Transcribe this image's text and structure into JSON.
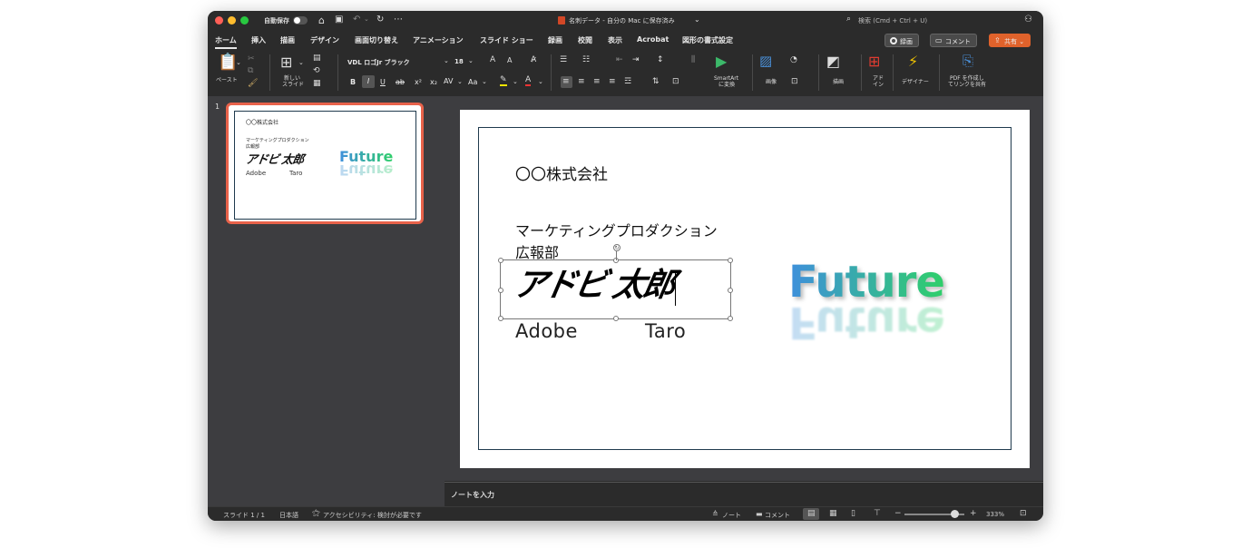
{
  "titlebar": {
    "autosave_label": "自動保存",
    "doc_title": "名刺データ - 自分の Mac に保存済み",
    "search_placeholder": "検索 (Cmd + Ctrl + U)"
  },
  "tabs": [
    "ホーム",
    "挿入",
    "描画",
    "デザイン",
    "画面切り替え",
    "アニメーション",
    "スライド ショー",
    "録画",
    "校閲",
    "表示",
    "Acrobat",
    "図形の書式設定"
  ],
  "top_buttons": {
    "record": "録画",
    "comment": "コメント",
    "share": "共有"
  },
  "ribbon": {
    "paste": "ペースト",
    "new_slide_1": "新しい",
    "new_slide_2": "スライド",
    "font_name": "VDL ロゴJr ブラック",
    "font_size": "18",
    "bold": "B",
    "italic": "I",
    "underline": "U",
    "strike": "ab",
    "superscript": "x²",
    "subscript": "x₂",
    "char_spacing": "AV",
    "change_case": "Aa",
    "smartart_1": "SmartArt",
    "smartart_2": "に変換",
    "picture": "画像",
    "draw": "描画",
    "addins_1": "アド",
    "addins_2": "イン",
    "designer": "デザイナー",
    "pdf_1": "PDF を作成し",
    "pdf_2": "てリンクを共有"
  },
  "thumbnail": {
    "number": "1",
    "company": "〇〇株式会社",
    "dept1": "マーケティングプロダクション",
    "dept2": "広報部",
    "name_jp": "アドビ 太郎",
    "name_first": "Adobe",
    "name_last": "Taro",
    "logo": "Future"
  },
  "slide": {
    "company": "〇〇株式会社",
    "dept1": "マーケティングプロダクション",
    "dept2": "広報部",
    "name_jp": "アドビ 太郎",
    "name_first": "Adobe",
    "name_last": "Taro",
    "logo": "Future"
  },
  "notes_placeholder": "ノートを入力",
  "status": {
    "slide_count": "スライド 1 / 1",
    "language": "日本語",
    "accessibility": "アクセシビリティ: 検討が必要です",
    "notes": "ノート",
    "comments": "コメント",
    "zoom": "333%"
  },
  "colors": {
    "close": "#ff5f57",
    "minimize": "#febc2e",
    "maximize": "#28c840",
    "share_button": "#e0622b",
    "selection_outline": "#e8624a",
    "logo_blue": "#3f8fdc",
    "logo_green": "#2fcf6a"
  }
}
